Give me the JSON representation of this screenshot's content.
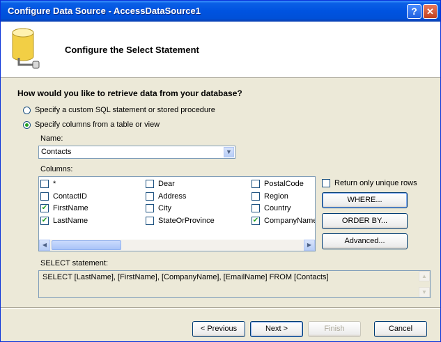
{
  "window": {
    "title": "Configure Data Source - AccessDataSource1",
    "help": "?",
    "close": "✕"
  },
  "header": {
    "title": "Configure the Select Statement",
    "icon": "database-icon"
  },
  "question": "How would you like to retrieve data from your database?",
  "options": [
    {
      "label": "Specify a custom SQL statement or stored procedure",
      "selected": false
    },
    {
      "label": "Specify columns from a table or view",
      "selected": true
    }
  ],
  "name_label": "Name:",
  "name_value": "Contacts",
  "columns_label": "Columns:",
  "columns": [
    {
      "label": "*",
      "checked": false
    },
    {
      "label": "ContactID",
      "checked": false
    },
    {
      "label": "FirstName",
      "checked": true
    },
    {
      "label": "LastName",
      "checked": true
    },
    {
      "label": "Dear",
      "checked": false
    },
    {
      "label": "Address",
      "checked": false
    },
    {
      "label": "City",
      "checked": false
    },
    {
      "label": "StateOrProvince",
      "checked": false
    },
    {
      "label": "PostalCode",
      "checked": false
    },
    {
      "label": "Region",
      "checked": false
    },
    {
      "label": "Country",
      "checked": false
    },
    {
      "label": "CompanyName",
      "checked": true
    }
  ],
  "unique_rows_label": "Return only unique rows",
  "buttons": {
    "where": "WHERE...",
    "order_by": "ORDER BY...",
    "advanced": "Advanced..."
  },
  "select_label": "SELECT statement:",
  "select_statement": "SELECT [LastName], [FirstName], [CompanyName], [EmailName] FROM [Contacts]",
  "footer": {
    "previous": "< Previous",
    "next": "Next >",
    "finish": "Finish",
    "cancel": "Cancel"
  },
  "colors": {
    "titlebar": "#0053e0",
    "dialog": "#ece9d8",
    "check": "#21a121"
  }
}
